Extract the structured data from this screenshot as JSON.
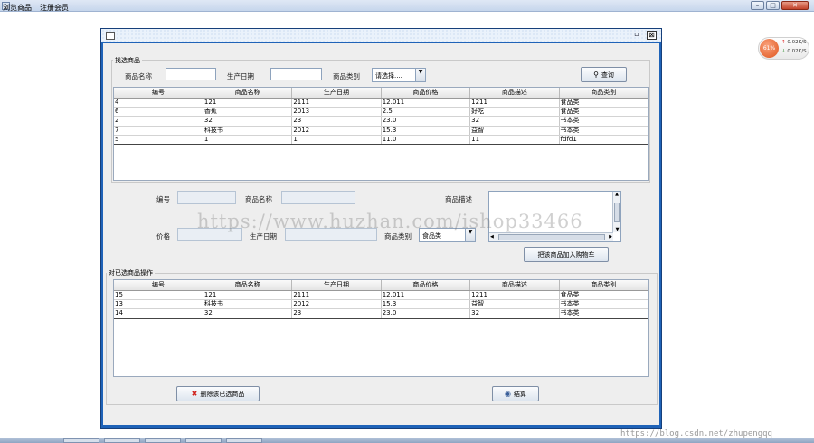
{
  "outer_window": {
    "title": "",
    "controls": {
      "minimize": "–",
      "maximize": "□",
      "close": "✕"
    }
  },
  "menubar": {
    "items": [
      "浏览商品",
      "注册会员"
    ]
  },
  "frame": {
    "restore_glyph": "▫",
    "close_glyph": "⊠"
  },
  "filter": {
    "group_label": "找选商品",
    "name_label": "商品名称",
    "name_value": "",
    "date_label": "生产日期",
    "date_value": "",
    "category_label": "商品类别",
    "category_value": "请选择....",
    "query_button": "查询"
  },
  "table_columns": [
    "编号",
    "商品名称",
    "生产日期",
    "商品价格",
    "商品描述",
    "商品类别"
  ],
  "product_rows": [
    [
      "4",
      "121",
      "2111",
      "12.011",
      "1211",
      "食品类"
    ],
    [
      "6",
      "香蕉",
      "2013",
      "2.5",
      "好吃",
      "食品类"
    ],
    [
      "2",
      "32",
      "23",
      "23.0",
      "32",
      "书本类"
    ],
    [
      "7",
      "科技书",
      "2012",
      "15.3",
      "益智",
      "书本类"
    ],
    [
      "5",
      "1",
      "1",
      "11.0",
      "11",
      "fdfd1"
    ]
  ],
  "detail": {
    "id_label": "编号",
    "id_value": "",
    "name_label": "商品名称",
    "name_value": "",
    "desc_label": "商品描述",
    "desc_value": "",
    "price_label": "价格",
    "price_value": "",
    "date_label": "生产日期",
    "date_value": "",
    "category_label": "商品类别",
    "category_value": "食品类",
    "add_to_cart_button": "把该商品加入购物车"
  },
  "cart": {
    "group_label": "对已选商品操作",
    "rows": [
      [
        "15",
        "121",
        "2111",
        "12.011",
        "1211",
        "食品类"
      ],
      [
        "13",
        "科技书",
        "2012",
        "15.3",
        "益智",
        "书本类"
      ],
      [
        "14",
        "32",
        "23",
        "23.0",
        "32",
        "书本类"
      ]
    ],
    "delete_button": "删除该已选商品",
    "checkout_button": "结算"
  },
  "net_widget": {
    "percent": "61%",
    "up": "0.02K/S",
    "down": "0.02K/S",
    "up_arrow": "↑",
    "down_arrow": "↓"
  },
  "watermark": "https://www.huzhan.com/ishop33466",
  "csdn_watermark": "https://blog.csdn.net/zhupengqq",
  "colors": {
    "frame_blue": "#1f63b8",
    "panel_bg": "#eeeeee",
    "delete_icon": "#d0201a",
    "net_ball": "#e0561f"
  }
}
